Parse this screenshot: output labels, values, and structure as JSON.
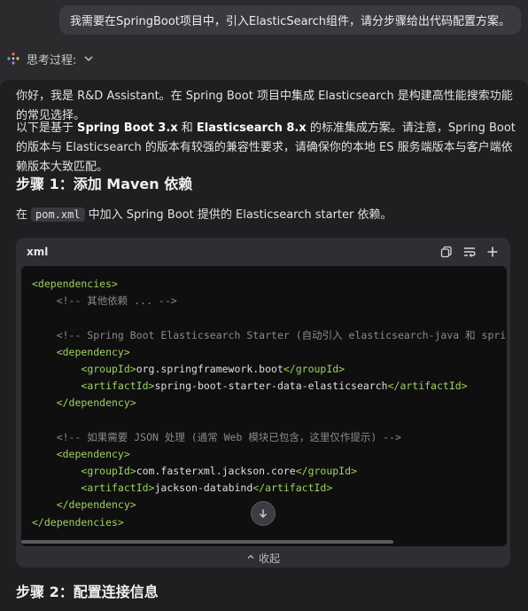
{
  "user_message": "我需要在SpringBoot项目中，引入ElasticSearch组件，请分步骤给出代码配置方案。",
  "thinking": {
    "label": "思考过程:"
  },
  "answer": {
    "intro": "你好，我是 R&D Assistant。在 Spring Boot 项目中集成 Elasticsearch 是构建高性能搜索功能的常见选择。",
    "p2_prefix": "以下是基于 ",
    "p2_bold1": "Spring Boot 3.x",
    "p2_mid": " 和 ",
    "p2_bold2": "Elasticsearch 8.x",
    "p2_suffix": " 的标准集成方案。请注意，Spring Boot 的版本与 Elasticsearch 的版本有较强的兼容性要求，请确保你的本地 ES 服务端版本与客户端依赖版本大致匹配。",
    "step1_title": "步骤 1：添加 Maven 依赖",
    "step1_prefix": "在",
    "step1_code": "pom.xml",
    "step1_suffix": "中加入 Spring Boot 提供的 Elasticsearch starter 依赖。",
    "code_block": {
      "language": "xml",
      "collapse_label": "收起",
      "lines": [
        {
          "type": "tag",
          "text": "<dependencies>"
        },
        {
          "type": "cmt",
          "text": "    <!-- 其他依赖 ... -->"
        },
        {
          "type": "blank",
          "text": " "
        },
        {
          "type": "cmt",
          "text": "    <!-- Spring Boot Elasticsearch Starter (自动引入 elasticsearch-java 和 spring-"
        },
        {
          "type": "tag",
          "text": "    <dependency>"
        },
        {
          "type": "mixed",
          "indent": "        ",
          "open": "<groupId>",
          "inner": "org.springframework.boot",
          "close": "</groupId>"
        },
        {
          "type": "mixed",
          "indent": "        ",
          "open": "<artifactId>",
          "inner": "spring-boot-starter-data-elasticsearch",
          "close": "</artifactId>"
        },
        {
          "type": "tag",
          "text": "    </dependency>"
        },
        {
          "type": "blank",
          "text": " "
        },
        {
          "type": "cmt",
          "text": "    <!-- 如果需要 JSON 处理 (通常 Web 模块已包含，这里仅作提示) -->"
        },
        {
          "type": "tag",
          "text": "    <dependency>"
        },
        {
          "type": "mixed",
          "indent": "        ",
          "open": "<groupId>",
          "inner": "com.fasterxml.jackson.core",
          "close": "</groupId>"
        },
        {
          "type": "mixed",
          "indent": "        ",
          "open": "<artifactId>",
          "inner": "jackson-databind",
          "close": "</artifactId>"
        },
        {
          "type": "tag",
          "text": "    </dependency>"
        },
        {
          "type": "tag",
          "text": "</dependencies>"
        }
      ]
    },
    "step2_title": "步骤 2：配置连接信息"
  },
  "icons": {
    "thinking": "sparkle-icon",
    "chevron": "chevron-down-icon",
    "copy": "copy-icon",
    "wrap": "wrap-lines-icon",
    "add": "plus-icon",
    "collapse": "chevron-up-icon",
    "scroll": "arrow-down-icon"
  },
  "colors": {
    "background": "#2b2b2e",
    "answer_panel": "#1f1f22",
    "code_bg": "#0f0f10",
    "xml_tag": "#9fd35a",
    "comment": "#8a8a8a",
    "user_bubble": "#3a3b40"
  }
}
